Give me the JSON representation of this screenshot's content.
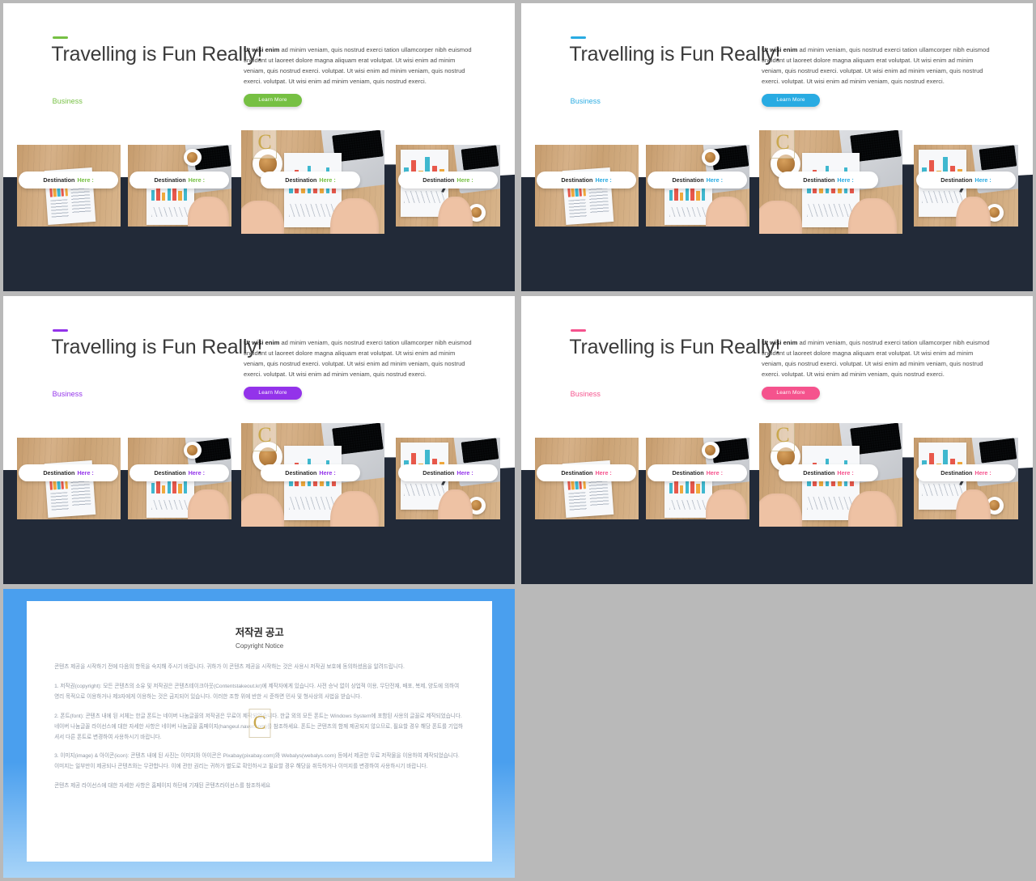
{
  "deck": {
    "slides": [
      {
        "id": "slide-1",
        "accent": "#76c043",
        "title": "Travelling is Fun Really!",
        "subtitle": "Business",
        "body_lead": "Ut wisi enim",
        "body": " ad minim veniam, quis nostrud exerci tation ullamcorper nibh euismod tincidunt ut laoreet dolore magna aliquam erat volutpat. Ut wisi enim ad minim veniam, quis nostrud exerci. volutpat. Ut wisi enim ad minim veniam, quis nostrud exerci. volutpat. Ut wisi enim ad minim veniam, quis nostrud exerci.",
        "button": "Learn More",
        "cards": [
          {
            "label": "Destination",
            "highlight": "Here :"
          },
          {
            "label": "Destination",
            "highlight": "Here :"
          },
          {
            "label": "Destination",
            "highlight": "Here :"
          },
          {
            "label": "Destination",
            "highlight": "Here :"
          }
        ]
      },
      {
        "id": "slide-2",
        "accent": "#29abe2",
        "title": "Travelling is Fun Really!",
        "subtitle": "Business",
        "body_lead": "Ut wisi enim",
        "body": " ad minim veniam, quis nostrud exerci tation ullamcorper nibh euismod tincidunt ut laoreet dolore magna aliquam erat volutpat. Ut wisi enim ad minim veniam, quis nostrud exerci. volutpat. Ut wisi enim ad minim veniam, quis nostrud exerci. volutpat. Ut wisi enim ad minim veniam, quis nostrud exerci.",
        "button": "Learn More",
        "cards": [
          {
            "label": "Destination",
            "highlight": "Here :"
          },
          {
            "label": "Destination",
            "highlight": "Here :"
          },
          {
            "label": "Destination",
            "highlight": "Here :"
          },
          {
            "label": "Destination",
            "highlight": "Here :"
          }
        ]
      },
      {
        "id": "slide-3",
        "accent": "#9333ea",
        "title": "Travelling is Fun Really!",
        "subtitle": "Business",
        "body_lead": "Ut wisi enim",
        "body": " ad minim veniam, quis nostrud exerci tation ullamcorper nibh euismod tincidunt ut laoreet dolore magna aliquam erat volutpat. Ut wisi enim ad minim veniam, quis nostrud exerci. volutpat. Ut wisi enim ad minim veniam, quis nostrud exerci. volutpat. Ut wisi enim ad minim veniam, quis nostrud exerci.",
        "button": "Learn More",
        "cards": [
          {
            "label": "Destination",
            "highlight": "Here :"
          },
          {
            "label": "Destination",
            "highlight": "Here :"
          },
          {
            "label": "Destination",
            "highlight": "Here :"
          },
          {
            "label": "Destination",
            "highlight": "Here :"
          }
        ]
      },
      {
        "id": "slide-4",
        "accent": "#f5538d",
        "title": "Travelling is Fun Really!",
        "subtitle": "Business",
        "body_lead": "Ut wisi enim",
        "body": " ad minim veniam, quis nostrud exerci tation ullamcorper nibh euismod tincidunt ut laoreet dolore magna aliquam erat volutpat. Ut wisi enim ad minim veniam, quis nostrud exerci. volutpat. Ut wisi enim ad minim veniam, quis nostrud exerci. volutpat. Ut wisi enim ad minim veniam, quis nostrud exerci.",
        "button": "Learn More",
        "cards": [
          {
            "label": "Destination",
            "highlight": "Here :"
          },
          {
            "label": "Destination",
            "highlight": "Here :"
          },
          {
            "label": "Destination",
            "highlight": "Here :"
          },
          {
            "label": "Destination",
            "highlight": "Here :"
          }
        ]
      }
    ]
  },
  "copyright": {
    "title": "저작권 공고",
    "subtitle": "Copyright Notice",
    "watermark": "C",
    "paragraphs": [
      "콘텐츠 제공을 시작하기 전에 다음의 항목을 숙지해 주시기 바랍니다. 귀하가 이 콘텐츠 제공을 시작하는 것은 사용시 저작권 보호에 동의하셨음을 알려드립니다.",
      "1. 저작권(copyright): 모든 콘텐츠의 소유 및 저작권은 콘텐츠테이크아웃(Contentstakeout.kr)에 제작자에게 있습니다. 사전 승낙 없이 상업적 이용, 무단전재, 배포, 복제, 양도에 의하여 영리 목적으로 이용하거나 제3자에게 이용하는 것은 금지되어 있습니다. 이러한 조항 위에 반한 시 준하면 민사 및 형사상의 사법을 받습니다.",
      "2. 폰트(font): 콘텐츠 내에 된 서체는 한글 폰트는 네이버 나눔글꼴의 저작권은 무료이 제작되었습니다. 한글 외의 모든 폰트는 Windows System에 포함된 사용의 글꼴로 제작되었습니다. 네이버 나눔글꼴 라이선스에 대한 자세한 사항은 네이버 나눔글꼴 홈페이지(hangeul.naver.com)를 참조하세요. 폰트는 콘텐츠의 함께 제공되지 않으므로, 필요할 경우 해당 폰트를 기입하셔서 다른 폰트로 변경하여 사용하시기 바랍니다.",
      "3. 이미지(image) & 아이콘(icon): 콘텐츠 내에 된 사진는 이미지와 아이콘은 Pixabay(pixabay.com)와 Webalys(webalys.com) 등에서 제공한 무료 저작물을 이용하여 제작되었습니다. 이미지는 일부만이 제공되나 콘텐츠와는 무관합니다. 이에 관한 권리는 귀하가 별도로 확인하시고 필요할 경우 해당을 취득하거나 이미지를 변경하여 사용하시기 바랍니다.",
      "콘텐츠 제공 라이선스에 대한 자세한 사항은 홈페이지 하단에 기재된 콘텐츠라이선스를 참조하세요"
    ]
  }
}
